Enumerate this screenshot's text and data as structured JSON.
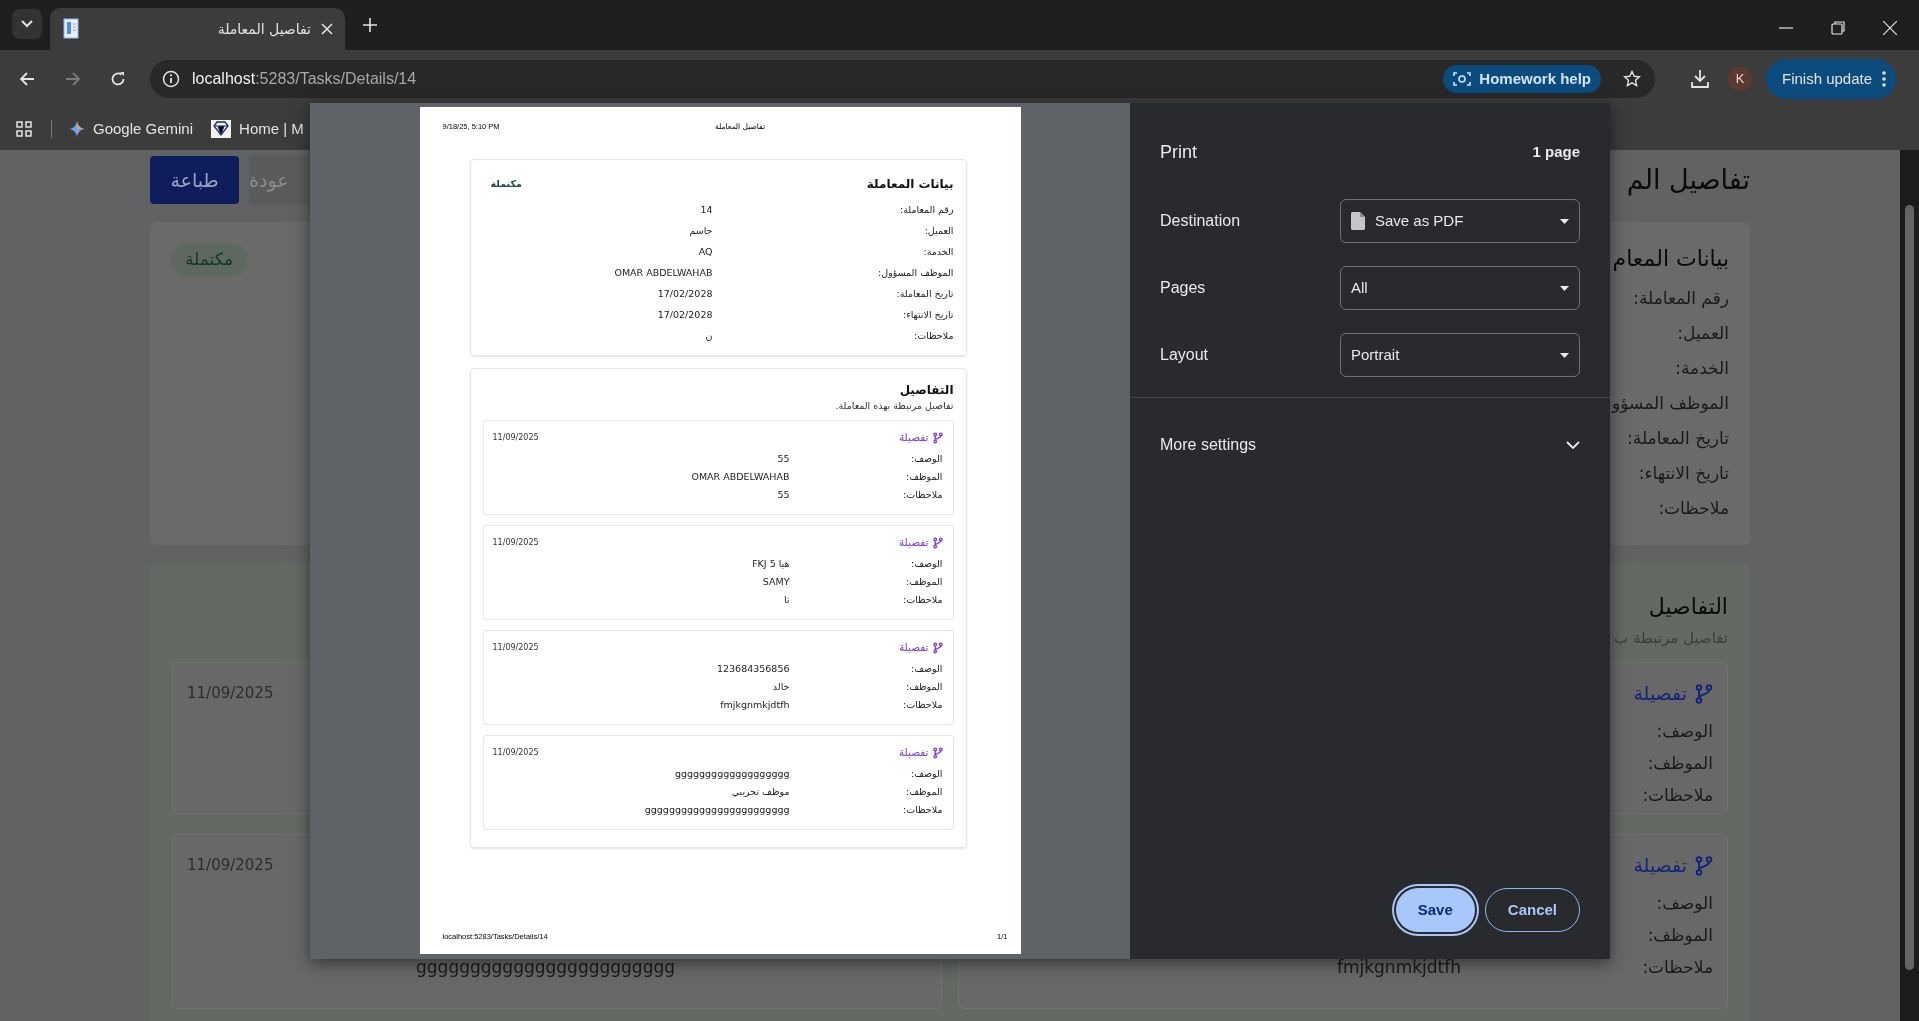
{
  "browser": {
    "tab": {
      "title": "تفاصيل المعاملة",
      "selected": true
    },
    "address": {
      "host": "localhost",
      "path": ":5283/Tasks/Details/14"
    },
    "chip": "Homework help",
    "avatar": "K",
    "update_button": "Finish update",
    "bookmark_gemini": "Google Gemini",
    "bookmark_site": "Home | M"
  },
  "page": {
    "title": "تفاصيل الم",
    "buttons": [
      {
        "kind": "secondary",
        "label": "عودة"
      },
      {
        "kind": "primary",
        "label": "طباعة"
      }
    ],
    "status_badge": "مكتملة",
    "info_card": {
      "title": "بيانات المعام",
      "labels": [
        "رقم المعاملة:",
        "العميل:",
        "الخدمة:",
        "الموظف المسؤو",
        "تاريخ المعاملة:",
        "تاريخ الانتهاء:",
        "ملاحظات:"
      ]
    },
    "details_card": {
      "title": "التفاصيل",
      "subtitle": "تفاصيل مرتبطة ب",
      "items": [
        {
          "heading": "تفصيلة",
          "labels": [
            "الوصف:",
            "الموظف:",
            "ملاحظات:"
          ]
        },
        {
          "date": "11/09/2025"
        },
        {
          "heading": "تفصيلة",
          "labels": [
            "الوصف:",
            "الموظف:",
            "ملاحظات:"
          ],
          "note": "fmjkgnmkjdtfh"
        },
        {
          "date": "11/09/2025",
          "note": "gggggggggggggggggggggggg"
        }
      ]
    }
  },
  "print_dialog": {
    "title": "Print",
    "page_count": "1 page",
    "settings": [
      {
        "kind": "destination",
        "label": "Destination",
        "value": "Save as PDF"
      },
      {
        "kind": "select",
        "label": "Pages",
        "value": "All"
      },
      {
        "kind": "select",
        "label": "Layout",
        "value": "Portrait"
      }
    ],
    "more_settings": {
      "label": "More settings",
      "expanded": false
    },
    "save_button": "Save",
    "cancel_button": "Cancel",
    "preview": {
      "header_date": "9/18/25, 5:10 PM",
      "header_title": "تفاصيل المعاملة",
      "footer_url": "localhost:5283/Tasks/Details/14",
      "footer_page": "1/1",
      "info_card": {
        "title": "بيانات المعاملة",
        "status": "مكتملة",
        "rows": [
          {
            "label": "رقم المعاملة:",
            "value": "14"
          },
          {
            "label": "العميل:",
            "value": "جاسم"
          },
          {
            "label": "الخدمة:",
            "value": "AQ"
          },
          {
            "label": "الموظف المسؤول:",
            "value": "OMAR ABDELWAHAB"
          },
          {
            "label": "تاريخ المعاملة:",
            "value": "17/02/2028"
          },
          {
            "label": "تاريخ الانتهاء:",
            "value": "17/02/2028"
          },
          {
            "label": "ملاحظات:",
            "value": "ن"
          }
        ]
      },
      "details_card": {
        "title": "التفاصيل",
        "subtitle": "تفاصيل مرتبطة بهذه المعاملة.",
        "items": [
          {
            "heading": "تفصيلة",
            "date": "11/09/2025",
            "rows": [
              {
                "label": "الوصف:",
                "value": "55"
              },
              {
                "label": "الموظف:",
                "value": "OMAR ABDELWAHAB"
              },
              {
                "label": "ملاحظات:",
                "value": "55"
              }
            ]
          },
          {
            "heading": "تفصيلة",
            "date": "11/09/2025",
            "rows": [
              {
                "label": "الوصف:",
                "value": "هيا FKJ 5"
              },
              {
                "label": "الموظف:",
                "value": "SAMY"
              },
              {
                "label": "ملاحظات:",
                "value": "تا"
              }
            ]
          },
          {
            "heading": "تفصيلة",
            "date": "11/09/2025",
            "rows": [
              {
                "label": "الوصف:",
                "value": "123684356856"
              },
              {
                "label": "الموظف:",
                "value": "خالد"
              },
              {
                "label": "ملاحظات:",
                "value": "fmjkgnmkjdtfh"
              }
            ]
          },
          {
            "heading": "تفصيلة",
            "date": "11/09/2025",
            "rows": [
              {
                "label": "الوصف:",
                "value": "ggggggggggggggggggg"
              },
              {
                "label": "الموظف:",
                "value": "موظف تجريبي"
              },
              {
                "label": "ملاحظات:",
                "value": "gggggggggggggggggggggggg"
              }
            ]
          }
        ]
      }
    }
  }
}
